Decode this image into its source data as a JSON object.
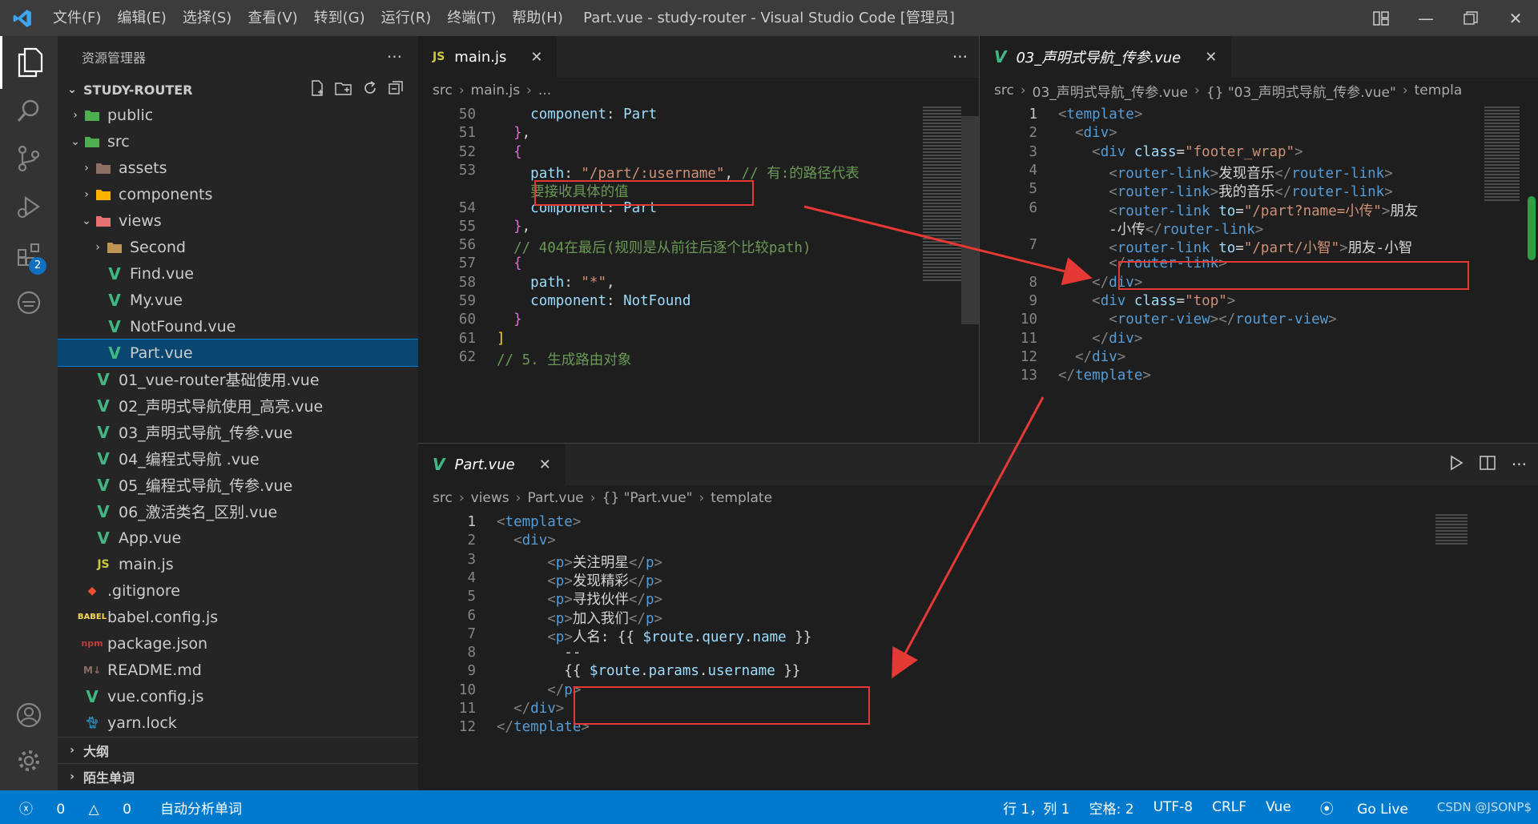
{
  "titlebar": {
    "menus": [
      "文件(F)",
      "编辑(E)",
      "选择(S)",
      "查看(V)",
      "转到(G)",
      "运行(R)",
      "终端(T)",
      "帮助(H)"
    ],
    "title": "Part.vue - study-router - Visual Studio Code [管理员]"
  },
  "activity": {
    "extensions_badge": "2"
  },
  "sidebar": {
    "header": "资源管理器",
    "project": "STUDY-ROUTER",
    "items": [
      {
        "label": "public",
        "type": "folder",
        "depth": 1,
        "open": false
      },
      {
        "label": "src",
        "type": "folder",
        "depth": 1,
        "open": true
      },
      {
        "label": "assets",
        "type": "folder",
        "depth": 2,
        "open": false
      },
      {
        "label": "components",
        "type": "folder",
        "depth": 2,
        "open": false
      },
      {
        "label": "views",
        "type": "folder",
        "depth": 2,
        "open": true
      },
      {
        "label": "Second",
        "type": "folder",
        "depth": 3,
        "open": false
      },
      {
        "label": "Find.vue",
        "type": "vue",
        "depth": 3
      },
      {
        "label": "My.vue",
        "type": "vue",
        "depth": 3
      },
      {
        "label": "NotFound.vue",
        "type": "vue",
        "depth": 3
      },
      {
        "label": "Part.vue",
        "type": "vue",
        "depth": 3,
        "selected": true
      },
      {
        "label": "01_vue-router基础使用.vue",
        "type": "vue",
        "depth": 2
      },
      {
        "label": "02_声明式导航使用_高亮.vue",
        "type": "vue",
        "depth": 2
      },
      {
        "label": "03_声明式导航_传参.vue",
        "type": "vue",
        "depth": 2
      },
      {
        "label": "04_编程式导航 .vue",
        "type": "vue",
        "depth": 2
      },
      {
        "label": "05_编程式导航_传参.vue",
        "type": "vue",
        "depth": 2
      },
      {
        "label": "06_激活类名_区别.vue",
        "type": "vue",
        "depth": 2
      },
      {
        "label": "App.vue",
        "type": "vue",
        "depth": 2
      },
      {
        "label": "main.js",
        "type": "js",
        "depth": 2
      },
      {
        "label": ".gitignore",
        "type": "git",
        "depth": 1
      },
      {
        "label": "babel.config.js",
        "type": "babel",
        "depth": 1
      },
      {
        "label": "package.json",
        "type": "npm",
        "depth": 1
      },
      {
        "label": "README.md",
        "type": "md",
        "depth": 1
      },
      {
        "label": "vue.config.js",
        "type": "vue",
        "depth": 1
      },
      {
        "label": "yarn.lock",
        "type": "yarn",
        "depth": 1
      }
    ],
    "outline": "大纲",
    "timeline": "陌生单词"
  },
  "editor_left": {
    "tab": "main.js",
    "tab_icon": "JS",
    "crumbs": [
      "src",
      "main.js",
      "..."
    ],
    "lines": [
      {
        "n": "50",
        "html": "    <span class='k'>component</span><span class='w'>: </span><span class='k'>Part</span>"
      },
      {
        "n": "51",
        "html": "  <span class='b'>}</span><span class='w'>,</span>"
      },
      {
        "n": "52",
        "html": "  <span class='b'>{</span>"
      },
      {
        "n": "53",
        "html": "    <span class='k'>path</span><span class='w'>: </span><span class='s'>\"/part/:username\"</span><span class='w'>, </span><span class='c'>// 有:的路径代表</span>"
      },
      {
        "n": "",
        "html": "    <span class='c'>要接收具体的值</span>"
      },
      {
        "n": "54",
        "html": "    <span class='k'>component</span><span class='w'>: </span><span class='k'>Part</span>"
      },
      {
        "n": "55",
        "html": "  <span class='b'>}</span><span class='w'>,</span>"
      },
      {
        "n": "56",
        "html": "  <span class='c'>// 404在最后(规则是从前往后逐个比较path)</span>"
      },
      {
        "n": "57",
        "html": "  <span class='b'>{</span>"
      },
      {
        "n": "58",
        "html": "    <span class='k'>path</span><span class='w'>: </span><span class='s'>\"*\"</span><span class='w'>,</span>"
      },
      {
        "n": "59",
        "html": "    <span class='k'>component</span><span class='w'>: </span><span class='k'>NotFound</span>"
      },
      {
        "n": "60",
        "html": "  <span class='b'>}</span>"
      },
      {
        "n": "61",
        "html": "<span class='y'>]</span>"
      },
      {
        "n": "62",
        "html": "<span class='c'>// 5. 生成路由对象</span>"
      }
    ]
  },
  "editor_right": {
    "tab": "03_声明式导航_传参.vue",
    "crumbs": [
      "src",
      "03_声明式导航_传参.vue",
      "{} \"03_声明式导航_传参.vue\"",
      "templa"
    ],
    "lines": [
      {
        "n": "1",
        "html": "<span class='p'>&lt;</span><span class='t'>template</span><span class='p'>&gt;</span>"
      },
      {
        "n": "2",
        "html": "  <span class='p'>&lt;</span><span class='t'>div</span><span class='p'>&gt;</span>"
      },
      {
        "n": "3",
        "html": "    <span class='p'>&lt;</span><span class='t'>div</span> <span class='a'>class</span><span class='w'>=</span><span class='s'>\"footer_wrap\"</span><span class='p'>&gt;</span>"
      },
      {
        "n": "4",
        "html": "      <span class='p'>&lt;</span><span class='t'>router-link</span><span class='p'>&gt;</span><span class='w'>发现音乐</span><span class='p'>&lt;/</span><span class='t'>router-link</span><span class='p'>&gt;</span>"
      },
      {
        "n": "5",
        "html": "      <span class='p'>&lt;</span><span class='t'>router-link</span><span class='p'>&gt;</span><span class='w'>我的音乐</span><span class='p'>&lt;/</span><span class='t'>router-link</span><span class='p'>&gt;</span>"
      },
      {
        "n": "6",
        "html": "      <span class='p'>&lt;</span><span class='t'>router-link</span> <span class='a'>to</span><span class='w'>=</span><span class='s'>\"/part?name=小传\"</span><span class='p'>&gt;</span><span class='w'>朋友</span>"
      },
      {
        "n": "",
        "html": "      <span class='w'>-小传</span><span class='p'>&lt;/</span><span class='t'>router-link</span><span class='p'>&gt;</span>"
      },
      {
        "n": "7",
        "html": "      <span class='p'>&lt;</span><span class='t'>router-link</span> <span class='a'>to</span><span class='w'>=</span><span class='s'>\"/part/小智\"</span><span class='p'>&gt;</span><span class='w'>朋友-小智</span>"
      },
      {
        "n": "",
        "html": "      <span class='p'>&lt;/</span><span class='t'>router-link</span><span class='p'>&gt;</span>"
      },
      {
        "n": "8",
        "html": "    <span class='p'>&lt;/</span><span class='t'>div</span><span class='p'>&gt;</span>"
      },
      {
        "n": "9",
        "html": "    <span class='p'>&lt;</span><span class='t'>div</span> <span class='a'>class</span><span class='w'>=</span><span class='s'>\"top\"</span><span class='p'>&gt;</span>"
      },
      {
        "n": "10",
        "html": "      <span class='p'>&lt;</span><span class='t'>router-view</span><span class='p'>&gt;&lt;/</span><span class='t'>router-view</span><span class='p'>&gt;</span>"
      },
      {
        "n": "11",
        "html": "    <span class='p'>&lt;/</span><span class='t'>div</span><span class='p'>&gt;</span>"
      },
      {
        "n": "12",
        "html": "  <span class='p'>&lt;/</span><span class='t'>div</span><span class='p'>&gt;</span>"
      },
      {
        "n": "13",
        "html": "<span class='p'>&lt;/</span><span class='t'>template</span><span class='p'>&gt;</span>"
      }
    ]
  },
  "editor_bottom": {
    "tab": "Part.vue",
    "crumbs": [
      "src",
      "views",
      "Part.vue",
      "{} \"Part.vue\"",
      "template"
    ],
    "lines": [
      {
        "n": "1",
        "html": "<span class='p'>&lt;</span><span class='t'>template</span><span class='p'>&gt;</span>"
      },
      {
        "n": "2",
        "html": "  <span class='p'>&lt;</span><span class='t'>div</span><span class='p'>&gt;</span>"
      },
      {
        "n": "3",
        "html": "      <span class='p'>&lt;</span><span class='t'>p</span><span class='p'>&gt;</span><span class='w'>关注明星</span><span class='p'>&lt;/</span><span class='t'>p</span><span class='p'>&gt;</span>"
      },
      {
        "n": "4",
        "html": "      <span class='p'>&lt;</span><span class='t'>p</span><span class='p'>&gt;</span><span class='w'>发现精彩</span><span class='p'>&lt;/</span><span class='t'>p</span><span class='p'>&gt;</span>"
      },
      {
        "n": "5",
        "html": "      <span class='p'>&lt;</span><span class='t'>p</span><span class='p'>&gt;</span><span class='w'>寻找伙伴</span><span class='p'>&lt;/</span><span class='t'>p</span><span class='p'>&gt;</span>"
      },
      {
        "n": "6",
        "html": "      <span class='p'>&lt;</span><span class='t'>p</span><span class='p'>&gt;</span><span class='w'>加入我们</span><span class='p'>&lt;/</span><span class='t'>p</span><span class='p'>&gt;</span>"
      },
      {
        "n": "7",
        "html": "      <span class='p'>&lt;</span><span class='t'>p</span><span class='p'>&gt;</span><span class='w'>人名: {{ </span><span class='k'>$route</span><span class='w'>.</span><span class='k'>query</span><span class='w'>.</span><span class='k'>name</span><span class='w'> }}</span>"
      },
      {
        "n": "8",
        "html": "        <span class='w'>--</span>"
      },
      {
        "n": "9",
        "html": "        <span class='w'>{{ </span><span class='k'>$route</span><span class='w'>.</span><span class='k'>params</span><span class='w'>.</span><span class='k'>username</span><span class='w'> }}</span>"
      },
      {
        "n": "10",
        "html": "      <span class='p'>&lt;/</span><span class='t'>p</span><span class='p'>&gt;</span>"
      },
      {
        "n": "11",
        "html": "  <span class='p'>&lt;/</span><span class='t'>div</span><span class='p'>&gt;</span>"
      },
      {
        "n": "12",
        "html": "<span class='p'>&lt;/</span><span class='t'>template</span><span class='p'>&gt;</span>"
      }
    ]
  },
  "statusbar": {
    "errors": "0",
    "warnings": "0",
    "task": "自动分析单词",
    "position": "行 1，列 1",
    "spaces": "空格: 2",
    "encoding": "UTF-8",
    "eol": "CRLF",
    "language": "Vue",
    "golive": "Go Live",
    "watermark": "CSDN @JSONP$"
  },
  "colors": {
    "accent": "#007acc",
    "highlight_box": "#e53935",
    "vue": "#41b883",
    "selection": "#094771"
  }
}
